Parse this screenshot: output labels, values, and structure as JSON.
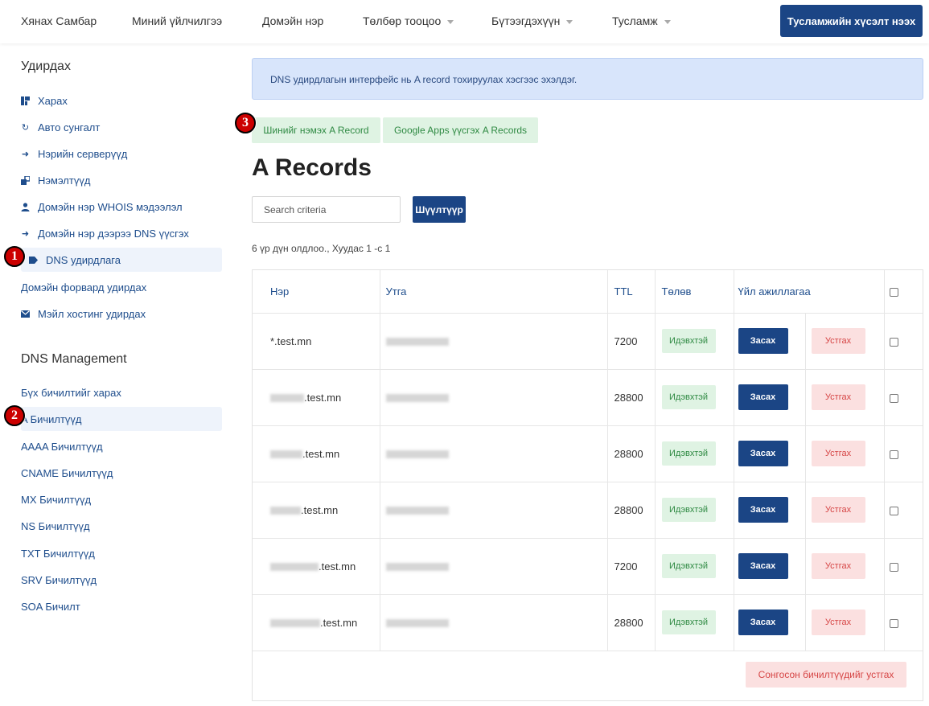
{
  "nav": {
    "items": [
      {
        "label": "Хянах Самбар",
        "dropdown": false
      },
      {
        "label": "Миний үйлчилгээ",
        "dropdown": false
      },
      {
        "label": "Домэйн нэр",
        "dropdown": false
      },
      {
        "label": "Төлбөр тооцоо",
        "dropdown": true
      },
      {
        "label": "Бүтээгдэхүүн",
        "dropdown": true
      },
      {
        "label": "Тусламж",
        "dropdown": true
      }
    ],
    "support_button": "Тусламжийн хүсэлт нээх"
  },
  "sidebar": {
    "manage_heading": "Удирдах",
    "manage_items": [
      {
        "label": "Харах",
        "icon": "dashboard-icon"
      },
      {
        "label": "Авто сунгалт",
        "icon": "refresh-icon"
      },
      {
        "label": "Нэрийн серверүүд",
        "icon": "arrow-right-icon"
      },
      {
        "label": "Нэмэлтүүд",
        "icon": "addon-icon"
      },
      {
        "label": "Домэйн нэр WHOIS мэдээлэл",
        "icon": "user-icon"
      },
      {
        "label": "Домэйн нэр дээрээ DNS үүсгэх",
        "icon": "arrow-right-icon"
      },
      {
        "label": "DNS удирдлага",
        "icon": "tag-icon",
        "active": true
      },
      {
        "label": "Домэйн форвард удирдах",
        "icon": ""
      },
      {
        "label": "Мэйл хостинг удирдах",
        "icon": "mail-icon"
      }
    ],
    "dns_heading": "DNS Management",
    "dns_items": [
      {
        "label": "Бүх бичилтийг харах"
      },
      {
        "label": "A Бичилтүүд",
        "active": true
      },
      {
        "label": "AAAA Бичилтүүд"
      },
      {
        "label": "CNAME Бичилтүүд"
      },
      {
        "label": "MX Бичилтүүд"
      },
      {
        "label": "NS Бичилтүүд"
      },
      {
        "label": "TXT Бичилтүүд"
      },
      {
        "label": "SRV Бичилтүүд"
      },
      {
        "label": "SOA Бичилт"
      }
    ]
  },
  "badges": [
    "1",
    "2",
    "3"
  ],
  "main": {
    "alert": "DNS удирдлагын интерфейс нь A record тохируулах хэсгээс эхэлдэг.",
    "add_button": "Шинийг нэмэх A Record",
    "google_button": "Google Apps үүсгэх A Records",
    "title": "A Records",
    "search_placeholder": "Search criteria",
    "filter_button": "Шүүлтүүр",
    "result_info": "6 үр дүн олдлоо., Хуудас 1 -с 1",
    "table": {
      "headers": [
        "Нэр",
        "Утга",
        "TTL",
        "Төлөв",
        "Үйл ажиллагаа"
      ],
      "rows": [
        {
          "name": "*.test.mn",
          "ttl": "7200",
          "status": "Идэвхтэй"
        },
        {
          "name": ".test.mn",
          "ttl": "28800",
          "status": "Идэвхтэй"
        },
        {
          "name": ".test.mn",
          "ttl": "28800",
          "status": "Идэвхтэй"
        },
        {
          "name": ".test.mn",
          "ttl": "28800",
          "status": "Идэвхтэй"
        },
        {
          "name": ".test.mn",
          "ttl": "7200",
          "status": "Идэвхтэй"
        },
        {
          "name": ".test.mn",
          "ttl": "28800",
          "status": "Идэвхтэй"
        }
      ],
      "edit_label": "Засах",
      "delete_label": "Устгах",
      "delete_selected": "Сонгосон бичилтүүдийг устгах"
    }
  },
  "colors": {
    "primary": "#1b4585",
    "link": "#1e4d8c",
    "success_bg": "#dff3e3",
    "success_text": "#2f8a43",
    "danger_bg": "#fbe0e0",
    "danger_text": "#d64545",
    "alert_bg": "#d8e5fb",
    "badge": "#cc0000"
  }
}
